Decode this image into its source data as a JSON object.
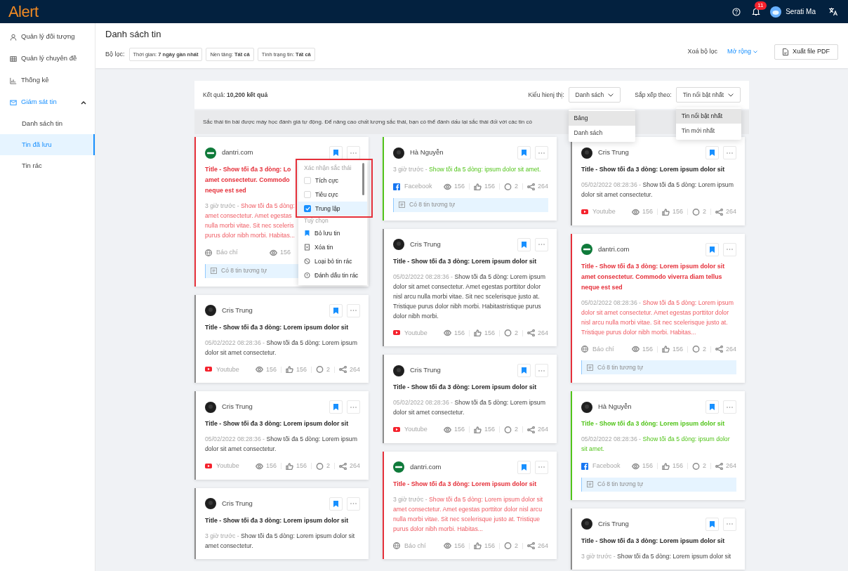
{
  "topbar": {
    "logo": "Alert",
    "notifications": "11",
    "user": "Serati Ma"
  },
  "sidebar": {
    "items": [
      {
        "label": "Quản lý đối tượng",
        "active": false
      },
      {
        "label": "Quản lý chuyên đề",
        "active": false
      },
      {
        "label": "Thống kê",
        "active": false
      },
      {
        "label": "Giám sát tin",
        "active": true,
        "expanded": true,
        "children": [
          {
            "label": "Danh sách tin",
            "selected": false
          },
          {
            "label": "Tin đã lưu",
            "selected": true
          },
          {
            "label": "Tin rác",
            "selected": false
          }
        ]
      }
    ]
  },
  "header": {
    "title": "Danh sách tin",
    "filter_label": "Bộ lọc:",
    "filters": [
      "Thời gian: **7 ngày gần nhất**",
      "Nền tảng: **Tất cả**",
      "Tình trạng tin: **Tất cả**"
    ],
    "clear": "Xoá bộ lọc",
    "expand": "Mở rộng",
    "export": "Xuất file PDF"
  },
  "toolbar": {
    "result": "Kết quả: **10,200 kết quả**",
    "view_label": "Kiểu hienj thị:",
    "view_value": "Danh sách",
    "view_options": [
      {
        "label": "Bảng",
        "selected": true
      },
      {
        "label": "Danh sách",
        "selected": false
      }
    ],
    "sort_label": "Sắp xếp theo:",
    "sort_value": "Tin nổi bật nhất",
    "sort_options": [
      {
        "label": "Tin nổi bật nhất",
        "selected": true
      },
      {
        "label": "Tin mới nhất",
        "selected": false
      }
    ]
  },
  "notice": "Sắc thái tin bài được máy học đánh giá tự động. Để nâng cao chất lượng sắc thái, bạn có thể đánh dấu lại sắc thái đối với các tin có",
  "columns": [
    [
      {
        "source": "dantri.com",
        "avatar": {
          "kind": "site"
        },
        "kind": "negative",
        "bookmarked": true,
        "title_lines": [
          "Title - Show tối đa 3 dòng: Lo",
          "amet consectetur. Commodo",
          "neque est sed"
        ],
        "time": "3 giờ trước -",
        "desc_lines": [
          "Show tối đa 5 dòng:",
          "amet consectetur. Amet egestas",
          "nulla morbi vitae. Sit nec sceleris",
          "purus dolor nibh morbi. Habitas..."
        ],
        "platform": {
          "kind": "news",
          "label": "Báo chí"
        },
        "stats": [
          {
            "kind": "views",
            "value": "156"
          }
        ],
        "similar": "Có 8 tin tương tự",
        "menu": {
          "section1": "Xác nhận sắc thái",
          "sentiments": [
            {
              "label": "Tích cực",
              "checked": false
            },
            {
              "label": "Tiêu cực",
              "checked": false
            },
            {
              "label": "Trung lập",
              "checked": true
            }
          ],
          "section2": "Tuỳ chọn",
          "actions": [
            {
              "kind": "bookmark",
              "label": "Bỏ lưu tin"
            },
            {
              "kind": "delete",
              "label": "Xóa tin"
            },
            {
              "kind": "block",
              "label": "Loại bỏ tin rác"
            },
            {
              "kind": "flag",
              "label": "Đánh dấu tin rác"
            }
          ]
        }
      },
      {
        "source": "Cris Trung",
        "avatar": {
          "kind": "person"
        },
        "kind": "neutral",
        "bookmarked": true,
        "title": "Title - Show tối đa 3 dòng: Lorem ipsum dolor sit",
        "time": "05/02/2022 08:28:36 -",
        "desc": "Show tối đa 5 dòng: Lorem ipsum dolor sit amet consectetur.",
        "platform": {
          "kind": "youtube",
          "label": "Youtube"
        },
        "stats": [
          {
            "kind": "views",
            "value": "156"
          },
          {
            "kind": "likes",
            "value": "156"
          },
          {
            "kind": "comments",
            "value": "2"
          },
          {
            "kind": "shares",
            "value": "264"
          }
        ]
      },
      {
        "source": "Cris Trung",
        "avatar": {
          "kind": "person"
        },
        "kind": "neutral",
        "bookmarked": true,
        "title": "Title - Show tối đa 3 dòng: Lorem ipsum dolor sit",
        "time": "05/02/2022 08:28:36 -",
        "desc": "Show tối đa 5 dòng: Lorem ipsum dolor sit amet consectetur.",
        "platform": {
          "kind": "youtube",
          "label": "Youtube"
        },
        "stats": [
          {
            "kind": "views",
            "value": "156"
          },
          {
            "kind": "likes",
            "value": "156"
          },
          {
            "kind": "comments",
            "value": "2"
          },
          {
            "kind": "shares",
            "value": "264"
          }
        ]
      },
      {
        "source": "Cris Trung",
        "avatar": {
          "kind": "person"
        },
        "kind": "neutral",
        "bookmarked": true,
        "title": "Title - Show tối đa 3 dòng: Lorem ipsum dolor sit",
        "time": "3 giờ trước -",
        "desc": "Show tối đa 5 dòng: Lorem ipsum dolor sit amet consectetur."
      }
    ],
    [
      {
        "source": "Hà Nguyễn",
        "avatar": {
          "kind": "person"
        },
        "kind": "positive",
        "bookmarked": true,
        "time": "3 giờ trước -",
        "desc": "Show tối đa 5 dòng: ipsum dolor sit amet.",
        "platform": {
          "kind": "facebook",
          "label": "Facebook"
        },
        "stats": [
          {
            "kind": "views",
            "value": "156"
          },
          {
            "kind": "likes",
            "value": "156"
          },
          {
            "kind": "comments",
            "value": "2"
          },
          {
            "kind": "shares",
            "value": "264"
          }
        ],
        "similar": "Có 8 tin tương tự"
      },
      {
        "source": "Cris Trung",
        "avatar": {
          "kind": "person"
        },
        "kind": "neutral",
        "bookmarked": true,
        "title": "Title - Show tối đa 3 dòng: Lorem ipsum dolor sit",
        "time": "05/02/2022 08:28:36 -",
        "desc": "Show tối đa 5 dòng: Lorem ipsum dolor sit amet consectetur. Amet egestas porttitor dolor nisl arcu nulla morbi vitae. Sit nec scelerisque justo at. Tristique purus dolor nibh morbi. Habitastristique purus dolor nibh morbi.",
        "platform": {
          "kind": "youtube",
          "label": "Youtube"
        },
        "stats": [
          {
            "kind": "views",
            "value": "156"
          },
          {
            "kind": "likes",
            "value": "156"
          },
          {
            "kind": "comments",
            "value": "2"
          },
          {
            "kind": "shares",
            "value": "264"
          }
        ]
      },
      {
        "source": "Cris Trung",
        "avatar": {
          "kind": "person"
        },
        "kind": "neutral",
        "bookmarked": true,
        "title": "Title - Show tối đa 3 dòng: Lorem ipsum dolor sit",
        "time": "05/02/2022 08:28:36 -",
        "desc": "Show tối đa 5 dòng: Lorem ipsum dolor sit amet consectetur.",
        "platform": {
          "kind": "youtube",
          "label": "Youtube"
        },
        "stats": [
          {
            "kind": "views",
            "value": "156"
          },
          {
            "kind": "likes",
            "value": "156"
          },
          {
            "kind": "comments",
            "value": "2"
          },
          {
            "kind": "shares",
            "value": "264"
          }
        ]
      },
      {
        "source": "dantri.com",
        "avatar": {
          "kind": "site"
        },
        "kind": "negative",
        "bookmarked": true,
        "title": "Title - Show tối đa 3 dòng: Lorem ipsum dolor sit",
        "time": "3 giờ trước -",
        "desc": "Show tối đa 5 dòng: Lorem ipsum dolor sit amet consectetur. Amet egestas porttitor dolor nisl arcu nulla morbi vitae. Sit nec scelerisque justo at. Tristique purus dolor nibh morbi. Habitas...",
        "platform": {
          "kind": "news",
          "label": "Báo chí"
        },
        "stats": [
          {
            "kind": "views",
            "value": "156"
          },
          {
            "kind": "likes",
            "value": "156"
          },
          {
            "kind": "comments",
            "value": "2"
          },
          {
            "kind": "shares",
            "value": "264"
          }
        ]
      }
    ],
    [
      {
        "source": "Cris Trung",
        "avatar": {
          "kind": "person"
        },
        "kind": "neutral",
        "bookmarked": true,
        "title": "Title - Show tối đa 3 dòng: Lorem ipsum dolor sit",
        "time": "05/02/2022 08:28:36 -",
        "desc": "Show tối đa 5 dòng: Lorem ipsum dolor sit amet consectetur.",
        "platform": {
          "kind": "youtube",
          "label": "Youtube"
        },
        "stats": [
          {
            "kind": "views",
            "value": "156"
          },
          {
            "kind": "likes",
            "value": "156"
          },
          {
            "kind": "comments",
            "value": "2"
          },
          {
            "kind": "shares",
            "value": "264"
          }
        ]
      },
      {
        "source": "dantri.com",
        "avatar": {
          "kind": "site"
        },
        "kind": "negative",
        "bookmarked": true,
        "title": "Title - Show tối đa 3 dòng: Lorem ipsum dolor sit amet consectetur. Commodo viverra diam tellus neque est sed",
        "time": "05/02/2022 08:28:36 -",
        "desc": "Show tối đa 5 dòng: Lorem ipsum dolor sit amet consectetur. Amet egestas porttitor dolor nisl arcu nulla morbi vitae. Sit nec scelerisque justo at. Tristique purus dolor nibh morbi. Habitas...",
        "platform": {
          "kind": "news",
          "label": "Báo chí"
        },
        "stats": [
          {
            "kind": "views",
            "value": "156"
          },
          {
            "kind": "likes",
            "value": "156"
          },
          {
            "kind": "comments",
            "value": "2"
          },
          {
            "kind": "shares",
            "value": "264"
          }
        ],
        "similar": "Có 8 tin tương tự"
      },
      {
        "source": "Hà Nguyễn",
        "avatar": {
          "kind": "person"
        },
        "kind": "positive",
        "bookmarked": true,
        "title": "Title - Show tối đa 3 dòng: Lorem ipsum dolor sit",
        "time": "05/02/2022 08:28:36 -",
        "desc": "Show tối đa 5 dòng: ipsum dolor sit amet.",
        "platform": {
          "kind": "facebook",
          "label": "Facebook"
        },
        "stats": [
          {
            "kind": "views",
            "value": "156"
          },
          {
            "kind": "likes",
            "value": "156"
          },
          {
            "kind": "comments",
            "value": "2"
          },
          {
            "kind": "shares",
            "value": "264"
          }
        ],
        "similar": "Có 8 tin tương tự"
      },
      {
        "source": "Cris Trung",
        "avatar": {
          "kind": "person"
        },
        "kind": "neutral",
        "bookmarked": true,
        "title": "Title - Show tối đa 3 dòng: Lorem ipsum dolor sit",
        "time": "3 giờ trước -",
        "desc": "Show tối đa 5 dòng: Lorem ipsum dolor sit"
      }
    ]
  ]
}
